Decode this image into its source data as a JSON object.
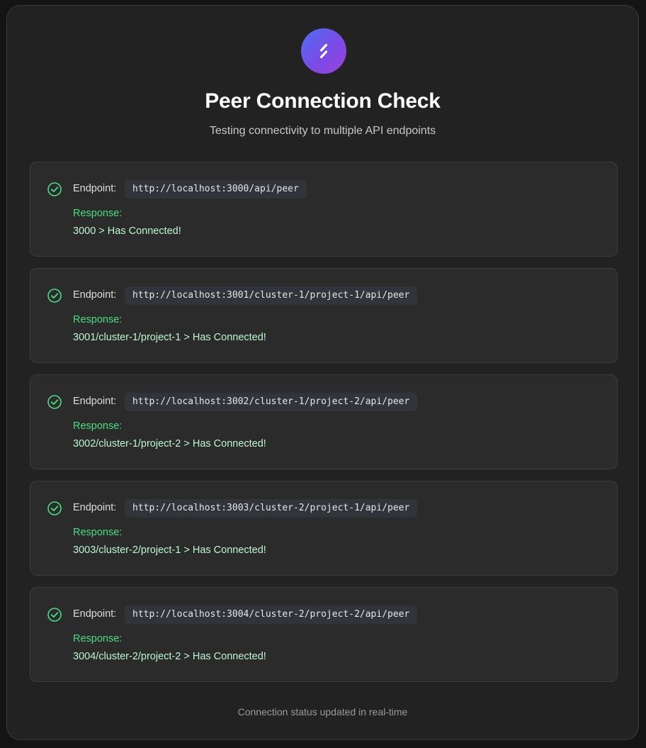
{
  "header": {
    "logo_icon": "link-slash-icon",
    "title": "Peer Connection Check",
    "subtitle": "Testing connectivity to multiple API endpoints"
  },
  "endpoint_label": "Endpoint:",
  "response_label": "Response:",
  "status_icon": "check-circle-icon",
  "endpoints": [
    {
      "url": "http://localhost:3000/api/peer",
      "response": "3000 > Has Connected!"
    },
    {
      "url": "http://localhost:3001/cluster-1/project-1/api/peer",
      "response": "3001/cluster-1/project-1 > Has Connected!"
    },
    {
      "url": "http://localhost:3002/cluster-1/project-2/api/peer",
      "response": "3002/cluster-1/project-2 > Has Connected!"
    },
    {
      "url": "http://localhost:3003/cluster-2/project-1/api/peer",
      "response": "3003/cluster-2/project-1 > Has Connected!"
    },
    {
      "url": "http://localhost:3004/cluster-2/project-2/api/peer",
      "response": "3004/cluster-2/project-2 > Has Connected!"
    }
  ],
  "footer": "Connection status updated in real-time",
  "colors": {
    "success": "#4ade80",
    "response_text": "#bbf7d0",
    "logo_gradient_start": "#4f6ff0",
    "logo_gradient_end": "#9b42d8"
  }
}
